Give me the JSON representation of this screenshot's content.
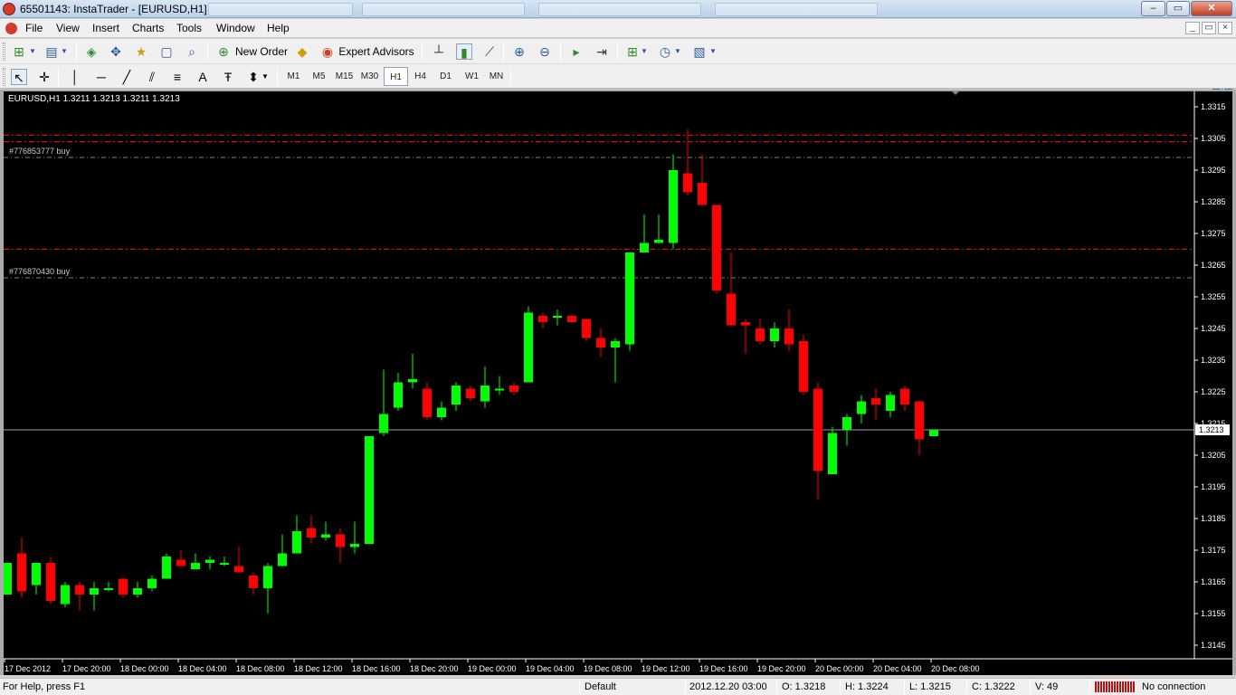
{
  "window": {
    "title": "65501143: InstaTrader - [EURUSD,H1]",
    "controls": {
      "minimize": "–",
      "maximize": "▭",
      "close": "✕"
    }
  },
  "menu": [
    "File",
    "View",
    "Insert",
    "Charts",
    "Tools",
    "Window",
    "Help"
  ],
  "toolbar": {
    "new_order": "New Order",
    "expert_advisors": "Expert Advisors",
    "timeframes": [
      "M1",
      "M5",
      "M15",
      "M30",
      "H1",
      "H4",
      "D1",
      "W1",
      "MN"
    ],
    "active_timeframe": "H1",
    "text_tool": "A"
  },
  "chart": {
    "header": "EURUSD,H1  1.3211 1.3213 1.3211 1.3213",
    "current_price_label": "1.3213",
    "colors": {
      "bull": "#00ff00",
      "bear": "#ff0000",
      "background": "#000000",
      "axis": "#ffffff"
    }
  },
  "chart_data": {
    "type": "candlestick",
    "symbol": "EURUSD",
    "timeframe": "H1",
    "ylim": [
      1.314,
      1.332
    ],
    "y_ticks": [
      "1.3315",
      "1.3305",
      "1.3295",
      "1.3285",
      "1.3275",
      "1.3265",
      "1.3255",
      "1.3245",
      "1.3235",
      "1.3225",
      "1.3215",
      "1.3205",
      "1.3195",
      "1.3185",
      "1.3175",
      "1.3165",
      "1.3155",
      "1.3145"
    ],
    "x_ticks": [
      "17 Dec 2012",
      "17 Dec 20:00",
      "18 Dec 00:00",
      "18 Dec 04:00",
      "18 Dec 08:00",
      "18 Dec 12:00",
      "18 Dec 16:00",
      "18 Dec 20:00",
      "19 Dec 00:00",
      "19 Dec 04:00",
      "19 Dec 08:00",
      "19 Dec 12:00",
      "19 Dec 16:00",
      "19 Dec 20:00",
      "20 Dec 00:00",
      "20 Dec 04:00",
      "20 Dec 08:00"
    ],
    "current_price": 1.3213,
    "order_lines": [
      {
        "label": "#776853777 buy",
        "price": 1.3299,
        "kind": "entry"
      },
      {
        "label": "#776870430 buy",
        "price": 1.3261,
        "kind": "entry"
      },
      {
        "label": "",
        "price": 1.3306,
        "kind": "stop"
      },
      {
        "label": "",
        "price": 1.3304,
        "kind": "stop"
      },
      {
        "label": "",
        "price": 1.327,
        "kind": "stop"
      }
    ],
    "candles": [
      {
        "o": 1.3161,
        "h": 1.3171,
        "l": 1.3161,
        "c": 1.3171
      },
      {
        "o": 1.3174,
        "h": 1.3179,
        "l": 1.316,
        "c": 1.3162
      },
      {
        "o": 1.3164,
        "h": 1.3171,
        "l": 1.3161,
        "c": 1.3171
      },
      {
        "o": 1.3171,
        "h": 1.3173,
        "l": 1.3158,
        "c": 1.3159
      },
      {
        "o": 1.3158,
        "h": 1.3165,
        "l": 1.3157,
        "c": 1.3164
      },
      {
        "o": 1.3164,
        "h": 1.3165,
        "l": 1.3156,
        "c": 1.3161
      },
      {
        "o": 1.3161,
        "h": 1.3165,
        "l": 1.3156,
        "c": 1.3163
      },
      {
        "o": 1.3163,
        "h": 1.3165,
        "l": 1.3162,
        "c": 1.3163
      },
      {
        "o": 1.3166,
        "h": 1.3166,
        "l": 1.316,
        "c": 1.3161
      },
      {
        "o": 1.3161,
        "h": 1.3165,
        "l": 1.316,
        "c": 1.3163
      },
      {
        "o": 1.3163,
        "h": 1.3167,
        "l": 1.3162,
        "c": 1.3166
      },
      {
        "o": 1.3166,
        "h": 1.3174,
        "l": 1.3166,
        "c": 1.3173
      },
      {
        "o": 1.3172,
        "h": 1.3175,
        "l": 1.317,
        "c": 1.317
      },
      {
        "o": 1.3169,
        "h": 1.3174,
        "l": 1.3169,
        "c": 1.3171
      },
      {
        "o": 1.3171,
        "h": 1.3173,
        "l": 1.3169,
        "c": 1.3172
      },
      {
        "o": 1.3171,
        "h": 1.3173,
        "l": 1.317,
        "c": 1.3171
      },
      {
        "o": 1.317,
        "h": 1.3176,
        "l": 1.3168,
        "c": 1.3168
      },
      {
        "o": 1.3167,
        "h": 1.3168,
        "l": 1.3161,
        "c": 1.3163
      },
      {
        "o": 1.3163,
        "h": 1.3171,
        "l": 1.3155,
        "c": 1.317
      },
      {
        "o": 1.317,
        "h": 1.318,
        "l": 1.317,
        "c": 1.3174
      },
      {
        "o": 1.3174,
        "h": 1.3186,
        "l": 1.3174,
        "c": 1.3181
      },
      {
        "o": 1.3182,
        "h": 1.3186,
        "l": 1.3177,
        "c": 1.3179
      },
      {
        "o": 1.3179,
        "h": 1.3184,
        "l": 1.3178,
        "c": 1.318
      },
      {
        "o": 1.318,
        "h": 1.3182,
        "l": 1.3171,
        "c": 1.3176
      },
      {
        "o": 1.3176,
        "h": 1.3184,
        "l": 1.3174,
        "c": 1.3177
      },
      {
        "o": 1.3177,
        "h": 1.3211,
        "l": 1.3177,
        "c": 1.3211
      },
      {
        "o": 1.3212,
        "h": 1.3232,
        "l": 1.3211,
        "c": 1.3218
      },
      {
        "o": 1.322,
        "h": 1.3231,
        "l": 1.3219,
        "c": 1.3228
      },
      {
        "o": 1.3228,
        "h": 1.3237,
        "l": 1.3226,
        "c": 1.3229
      },
      {
        "o": 1.3226,
        "h": 1.3228,
        "l": 1.3216,
        "c": 1.3217
      },
      {
        "o": 1.3217,
        "h": 1.3222,
        "l": 1.3216,
        "c": 1.322
      },
      {
        "o": 1.3221,
        "h": 1.3228,
        "l": 1.3219,
        "c": 1.3227
      },
      {
        "o": 1.3226,
        "h": 1.3227,
        "l": 1.3222,
        "c": 1.3223
      },
      {
        "o": 1.3222,
        "h": 1.3233,
        "l": 1.322,
        "c": 1.3227
      },
      {
        "o": 1.3226,
        "h": 1.323,
        "l": 1.3224,
        "c": 1.3226
      },
      {
        "o": 1.3227,
        "h": 1.3228,
        "l": 1.3224,
        "c": 1.3225
      },
      {
        "o": 1.3228,
        "h": 1.3252,
        "l": 1.3228,
        "c": 1.325
      },
      {
        "o": 1.3249,
        "h": 1.325,
        "l": 1.3245,
        "c": 1.3247
      },
      {
        "o": 1.3249,
        "h": 1.3251,
        "l": 1.3246,
        "c": 1.3249
      },
      {
        "o": 1.3249,
        "h": 1.3249,
        "l": 1.3247,
        "c": 1.3247
      },
      {
        "o": 1.3248,
        "h": 1.3248,
        "l": 1.3241,
        "c": 1.3242
      },
      {
        "o": 1.3242,
        "h": 1.3245,
        "l": 1.3236,
        "c": 1.3239
      },
      {
        "o": 1.3239,
        "h": 1.3242,
        "l": 1.3228,
        "c": 1.3241
      },
      {
        "o": 1.324,
        "h": 1.3269,
        "l": 1.3238,
        "c": 1.3269
      },
      {
        "o": 1.3269,
        "h": 1.3281,
        "l": 1.3269,
        "c": 1.3272
      },
      {
        "o": 1.3272,
        "h": 1.3281,
        "l": 1.3272,
        "c": 1.3273
      },
      {
        "o": 1.3272,
        "h": 1.33,
        "l": 1.327,
        "c": 1.3295
      },
      {
        "o": 1.3294,
        "h": 1.3308,
        "l": 1.3287,
        "c": 1.3288
      },
      {
        "o": 1.3291,
        "h": 1.33,
        "l": 1.3284,
        "c": 1.3284
      },
      {
        "o": 1.3284,
        "h": 1.3284,
        "l": 1.3256,
        "c": 1.3257
      },
      {
        "o": 1.3256,
        "h": 1.3269,
        "l": 1.3246,
        "c": 1.3246
      },
      {
        "o": 1.3247,
        "h": 1.3248,
        "l": 1.3237,
        "c": 1.3246
      },
      {
        "o": 1.3245,
        "h": 1.3248,
        "l": 1.324,
        "c": 1.3241
      },
      {
        "o": 1.3241,
        "h": 1.3247,
        "l": 1.3239,
        "c": 1.3245
      },
      {
        "o": 1.3245,
        "h": 1.3251,
        "l": 1.3238,
        "c": 1.324
      },
      {
        "o": 1.3241,
        "h": 1.3243,
        "l": 1.3224,
        "c": 1.3225
      },
      {
        "o": 1.3226,
        "h": 1.3228,
        "l": 1.3191,
        "c": 1.32
      },
      {
        "o": 1.3199,
        "h": 1.3214,
        "l": 1.3199,
        "c": 1.3212
      },
      {
        "o": 1.3213,
        "h": 1.3218,
        "l": 1.3208,
        "c": 1.3217
      },
      {
        "o": 1.3218,
        "h": 1.3224,
        "l": 1.3215,
        "c": 1.3222
      },
      {
        "o": 1.3223,
        "h": 1.3226,
        "l": 1.3216,
        "c": 1.3221
      },
      {
        "o": 1.3219,
        "h": 1.3225,
        "l": 1.3217,
        "c": 1.3224
      },
      {
        "o": 1.3226,
        "h": 1.3227,
        "l": 1.3219,
        "c": 1.3221
      },
      {
        "o": 1.3222,
        "h": 1.3222,
        "l": 1.3205,
        "c": 1.321
      },
      {
        "o": 1.3211,
        "h": 1.3213,
        "l": 1.3211,
        "c": 1.3213
      }
    ]
  },
  "status": {
    "help": "For Help, press F1",
    "profile": "Default",
    "datetime": "2012.12.20 03:00",
    "open": "O: 1.3218",
    "high": "H: 1.3224",
    "low": "L: 1.3215",
    "close": "C: 1.3222",
    "volume": "V: 49",
    "connection": "No connection"
  }
}
